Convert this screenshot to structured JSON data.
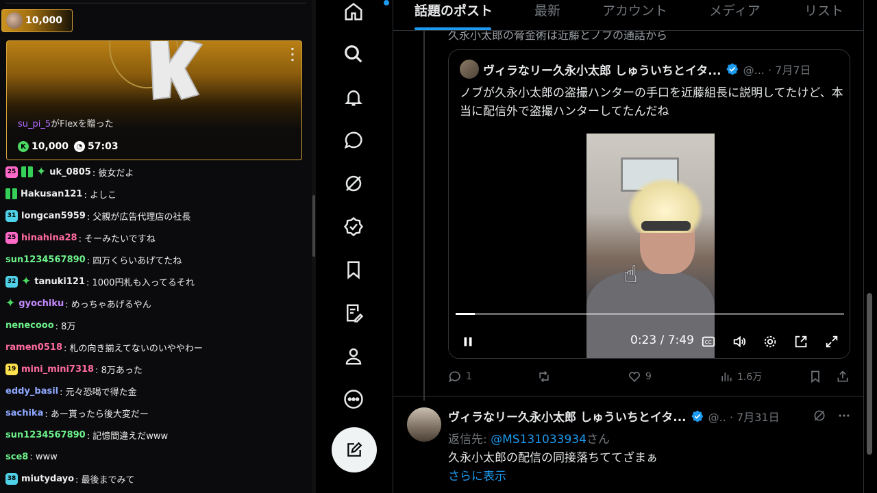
{
  "chat": {
    "pill_amount": "10,000",
    "flex_card": {
      "user": "su_pi_5",
      "message": "がFlexを贈った",
      "amount": "10,000",
      "duration": "57:03"
    },
    "lines": [
      {
        "badge": "25",
        "badge_color": "#ff69c8",
        "gift": true,
        "spark": true,
        "user": "uk_0805",
        "user_color": "#eeeeee",
        "text": ": 彼女だよ"
      },
      {
        "badge": "",
        "gift": true,
        "spark": false,
        "user": "Hakusan121",
        "user_color": "#eeeeee",
        "text": ": よしこ"
      },
      {
        "badge": "31",
        "badge_color": "#4fd1e8",
        "gift": false,
        "spark": false,
        "user": "longcan5959",
        "user_color": "#eeeeee",
        "text": ": 父親が広告代理店の社長"
      },
      {
        "badge": "25",
        "badge_color": "#ff69c8",
        "gift": false,
        "spark": false,
        "user": "hinahina28",
        "user_color": "#ff6b9d",
        "text": ": そーみたいですね"
      },
      {
        "badge": "",
        "gift": false,
        "spark": false,
        "user": "sun1234567890",
        "user_color": "#6cf08a",
        "text": ": 四万くらいあげてたね"
      },
      {
        "badge": "32",
        "badge_color": "#4fd1e8",
        "gift": false,
        "spark": true,
        "user": "tanuki121",
        "user_color": "#eeeeee",
        "text": ": 1000円札も入ってるそれ"
      },
      {
        "badge": "",
        "gift": false,
        "spark": true,
        "user": "gyochiku",
        "user_color": "#c58aff",
        "text": ": めっちゃあげるやん"
      },
      {
        "badge": "",
        "gift": false,
        "spark": false,
        "user": "nenecooo",
        "user_color": "#6cf08a",
        "text": ": 8万"
      },
      {
        "badge": "",
        "gift": false,
        "spark": false,
        "user": "ramen0518",
        "user_color": "#ff6b9d",
        "text": ": 札の向き揃えてないのいややわー"
      },
      {
        "badge": "19",
        "badge_color": "#ffe14d",
        "gift": false,
        "spark": false,
        "user": "mini_mini7318",
        "user_color": "#ff6b9d",
        "text": ": 8万あった"
      },
      {
        "badge": "",
        "gift": false,
        "spark": false,
        "user": "eddy_basil",
        "user_color": "#8fa8ff",
        "text": ": 元々恐喝で得た金"
      },
      {
        "badge": "",
        "gift": false,
        "spark": false,
        "user": "sachika",
        "user_color": "#8fa8ff",
        "text": ": あー貰ったら後大変だー"
      },
      {
        "badge": "",
        "gift": false,
        "spark": false,
        "user": "sun1234567890",
        "user_color": "#6cf08a",
        "text": ": 記憶間違えだwww"
      },
      {
        "badge": "",
        "gift": false,
        "spark": false,
        "user": "sce8",
        "user_color": "#6cf08a",
        "text": ": www"
      },
      {
        "badge": "38",
        "badge_color": "#4fd1e8",
        "gift": false,
        "spark": false,
        "user": "miutydayo",
        "user_color": "#eeeeee",
        "text": ": 最後までみて"
      }
    ]
  },
  "sidebar": {
    "icons": [
      "home-icon",
      "search-icon",
      "notifications-icon",
      "messages-icon",
      "grok-icon",
      "verified-icon",
      "bookmarks-icon",
      "articles-icon",
      "profile-icon",
      "more-icon"
    ],
    "compose_icon": "compose-icon"
  },
  "tabs": [
    {
      "label": "話題のポスト",
      "active": true
    },
    {
      "label": "最新",
      "active": false
    },
    {
      "label": "アカウント",
      "active": false
    },
    {
      "label": "メディア",
      "active": false
    },
    {
      "label": "リスト",
      "active": false
    }
  ],
  "cut_text": "久永小太郎の脅金術は近藤とノブの通話から",
  "quote": {
    "name": "ヴィラなリー久永小太郎 しゅういちとイタ...",
    "meta": "@... · 7月7日",
    "text": "ノブが久永小太郎の盗撮ハンターの手口を近藤組長に説明してたけど、本当に配信外で盗撮ハンターしてたんだね",
    "video": {
      "time": "0:23 / 7:49",
      "progress_fraction": 0.049
    }
  },
  "actions": {
    "replies": "1",
    "reposts": "",
    "likes": "9",
    "views": "1.6万"
  },
  "post2": {
    "name": "ヴィラなリー久永小太郎 しゅういちとイタ...",
    "meta": "@.. · 7月31日",
    "reply_label": "返信先: ",
    "reply_handle": "@MS131033934",
    "reply_suffix": "さん",
    "text": "久永小太郎の配信の同接落ちててざまぁ",
    "show_more": "さらに表示"
  },
  "colors": {
    "accent": "#1d9bf0",
    "gold": "#d9a43a",
    "bg": "#000000"
  }
}
